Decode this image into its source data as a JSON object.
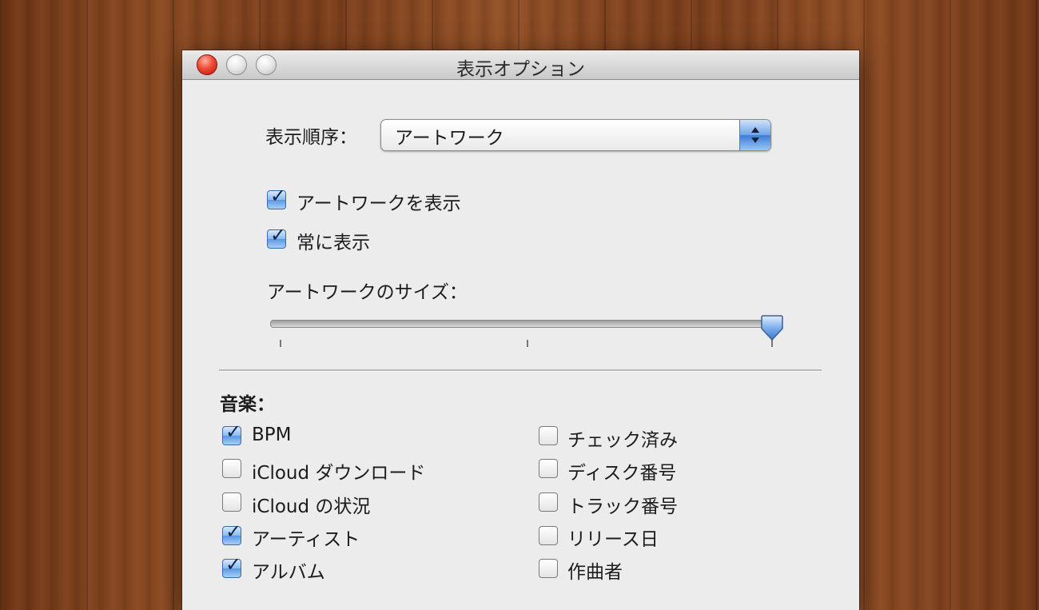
{
  "window": {
    "title": "表示オプション"
  },
  "sort": {
    "label": "表示順序：",
    "value": "アートワーク"
  },
  "options": {
    "show_artwork": {
      "label": "アートワークを表示",
      "checked": true
    },
    "always_show": {
      "label": "常に表示",
      "checked": true
    }
  },
  "artwork_size": {
    "label": "アートワークのサイズ：",
    "value_fraction": 1.0
  },
  "music": {
    "heading": "音楽：",
    "left_column": [
      {
        "label": "BPM",
        "checked": true
      },
      {
        "label": "iCloud ダウンロード",
        "checked": false
      },
      {
        "label": "iCloud の状況",
        "checked": false
      },
      {
        "label": "アーティスト",
        "checked": true
      },
      {
        "label": "アルバム",
        "checked": true
      }
    ],
    "right_column": [
      {
        "label": "チェック済み",
        "checked": false
      },
      {
        "label": "ディスク番号",
        "checked": false
      },
      {
        "label": "トラック番号",
        "checked": false
      },
      {
        "label": "リリース日",
        "checked": false
      },
      {
        "label": "作曲者",
        "checked": false
      }
    ]
  },
  "icons": {
    "close": "close-icon",
    "minimize": "minimize-icon",
    "zoom": "zoom-icon",
    "check": "checkmark-icon",
    "stepper": "up-down-arrows-icon"
  },
  "colors": {
    "window_bg": "#ececec",
    "accent_blue": "#5b97e3",
    "close_red": "#f04a34",
    "wood": "#7a3f1c"
  }
}
